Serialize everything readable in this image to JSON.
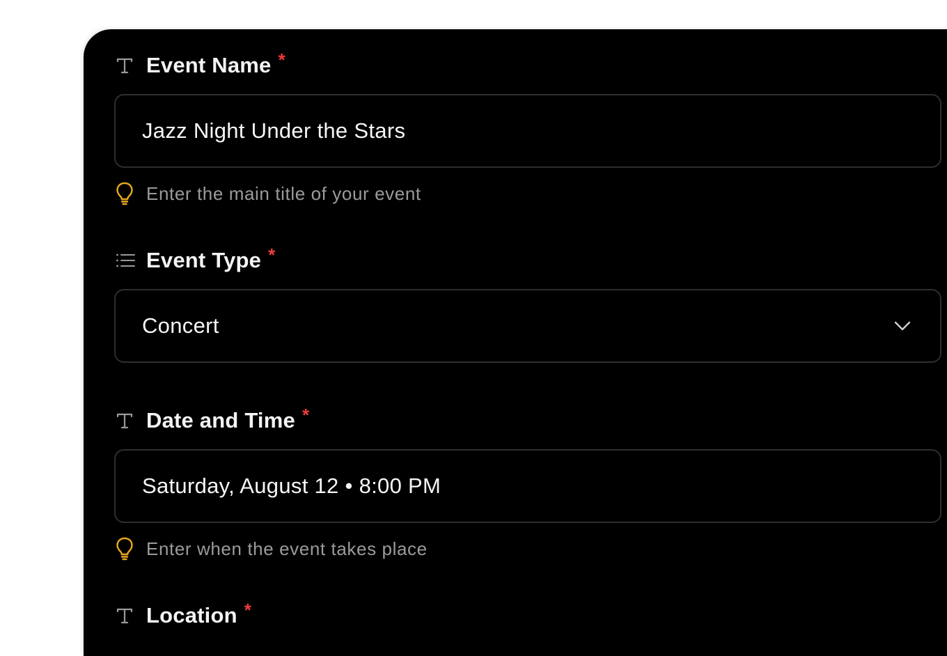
{
  "form": {
    "event_name": {
      "label": "Event Name",
      "required_mark": "*",
      "value": "Jazz Night Under the Stars",
      "hint": "Enter the main title of your event",
      "icon": "text-icon"
    },
    "event_type": {
      "label": "Event Type",
      "required_mark": "*",
      "value": "Concert",
      "icon": "list-icon"
    },
    "date_time": {
      "label": "Date and Time",
      "required_mark": "*",
      "value": "Saturday, August 12 • 8:00 PM",
      "hint": "Enter when the event takes place",
      "icon": "text-icon"
    },
    "location": {
      "label": "Location",
      "required_mark": "*",
      "icon": "text-icon"
    }
  },
  "colors": {
    "background": "#000000",
    "required": "#ef3b3b",
    "hint_icon": "#e9a820",
    "border": "#2e2e2e"
  }
}
